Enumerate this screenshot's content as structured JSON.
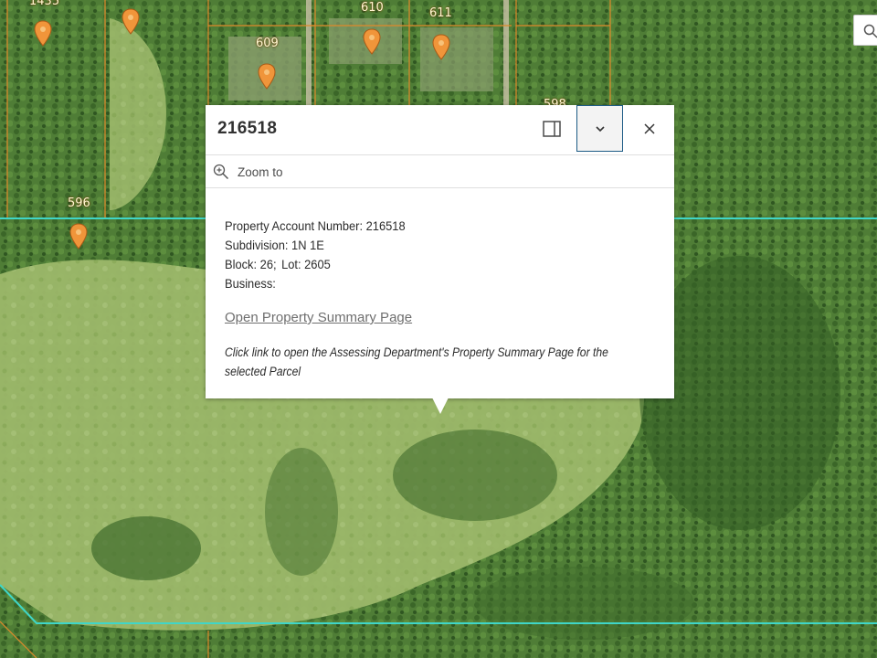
{
  "map": {
    "parcel_labels": [
      "1435",
      "609",
      "610",
      "611",
      "598",
      "596"
    ],
    "colors": {
      "parcel_line": "#e0892b",
      "boundary_line": "#3fd6c8",
      "marker": "#f0953a",
      "vegetation_light": "#9cb86a",
      "vegetation_dark": "#3f6b2c"
    }
  },
  "search": {
    "icon": "search-icon"
  },
  "popup": {
    "title": "216518",
    "dock_icon": "dock-icon",
    "collapse_icon": "chevron-down-icon",
    "close_icon": "close-icon",
    "zoom_label": "Zoom to",
    "zoom_icon": "zoom-in-icon",
    "fields": {
      "account": "Property Account Number: 216518",
      "subdivision": "Subdivision: 1N 1E",
      "block": "Block: 26;",
      "lot": "Lot:  2605",
      "business": "Business:"
    },
    "link_text": "Open Property Summary Page",
    "note": "Click link to open the Assessing Department's Property Summary Page for the selected Parcel"
  }
}
